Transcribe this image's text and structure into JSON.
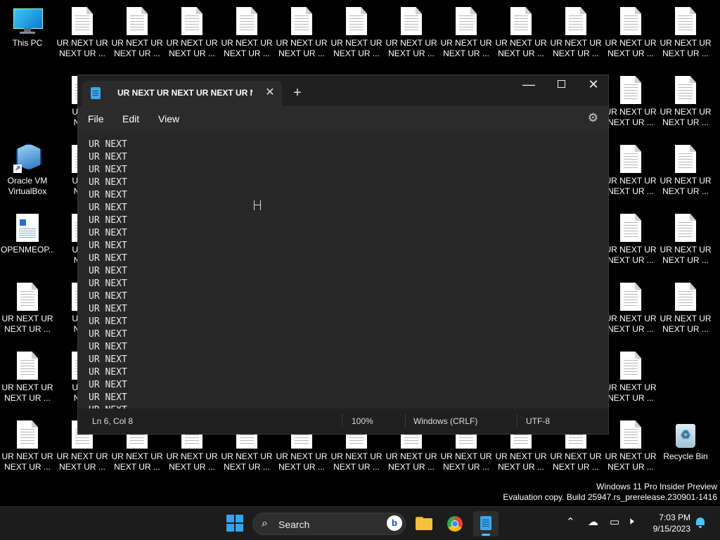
{
  "desktop": {
    "shortcuts": [
      {
        "name": "this-pc-shortcut",
        "label": "This PC",
        "icon": "pc-icon",
        "col": 0,
        "row": 0
      },
      {
        "name": "virtualbox-shortcut",
        "label": "Oracle VM\nVirtualBox",
        "icon": "virtualbox-icon",
        "col": 0,
        "row": 2
      },
      {
        "name": "openmeop-shortcut",
        "label": "OPENMEOP...",
        "icon": "odt-document-icon",
        "col": 0,
        "row": 3
      },
      {
        "name": "recycle-bin-shortcut",
        "label": "Recycle Bin",
        "icon": "recycle-bin-icon",
        "col": 12,
        "row": 6
      }
    ],
    "file_label": "UR NEXT UR\nNEXT UR ...",
    "file_label_clipped": "UR N\nNEX"
  },
  "notepad": {
    "tab_title": "UR NEXT UR NEXT UR NEXT UR NE",
    "menu": {
      "file": "File",
      "edit": "Edit",
      "view": "View"
    },
    "text_lines": [
      "UR NEXT",
      "UR NEXT",
      "UR NEXT",
      "UR NEXT",
      "UR NEXT",
      "UR NEXT",
      "UR NEXT",
      "UR NEXT",
      "UR NEXT",
      "UR NEXT",
      "UR NEXT",
      "UR NEXT",
      "UR NEXT",
      "UR NEXT",
      "UR NEXT",
      "UR NEXT",
      "UR NEXT",
      "UR NEXT",
      "UR NEXT",
      "UR NEXT",
      "UR NEXT",
      "UR NEXT"
    ],
    "status": {
      "position": "Ln 6, Col 8",
      "zoom": "100%",
      "line_ending": "Windows (CRLF)",
      "encoding": "UTF-8"
    }
  },
  "watermark": {
    "line1": "Windows 11 Pro Insider Preview",
    "line2": "Evaluation copy. Build 25947.rs_prerelease.230901-1416"
  },
  "taskbar": {
    "search_placeholder": "Search",
    "time": "7:03 PM",
    "date": "9/15/2023"
  },
  "colors": {
    "accent": "#4cc2ff",
    "window_bg": "#202020",
    "editor_bg": "#272727"
  }
}
